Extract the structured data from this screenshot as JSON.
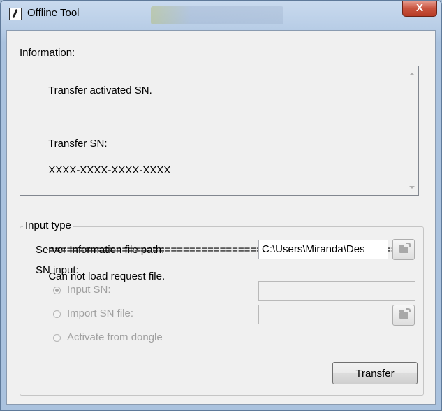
{
  "window": {
    "title": "Offline Tool",
    "close_label": "X"
  },
  "information": {
    "label": "Information:",
    "lines": [
      "Transfer activated SN.",
      "",
      "Transfer SN:",
      "XXXX-XXXX-XXXX-XXXX",
      "",
      "",
      "=========================================================",
      "Can not load request file."
    ]
  },
  "input_type": {
    "legend": "Input type",
    "server_info_label": "Server Information file path:",
    "server_info_value": "C:\\Users\\Miranda\\Des",
    "sn_input_label": "SN input:",
    "options": [
      {
        "label": "Input SN:",
        "checked": true
      },
      {
        "label": "Import SN file:",
        "checked": false
      },
      {
        "label": "Activate from dongle",
        "checked": false
      }
    ],
    "input_sn_value": "",
    "import_sn_value": "",
    "transfer_label": "Transfer"
  }
}
